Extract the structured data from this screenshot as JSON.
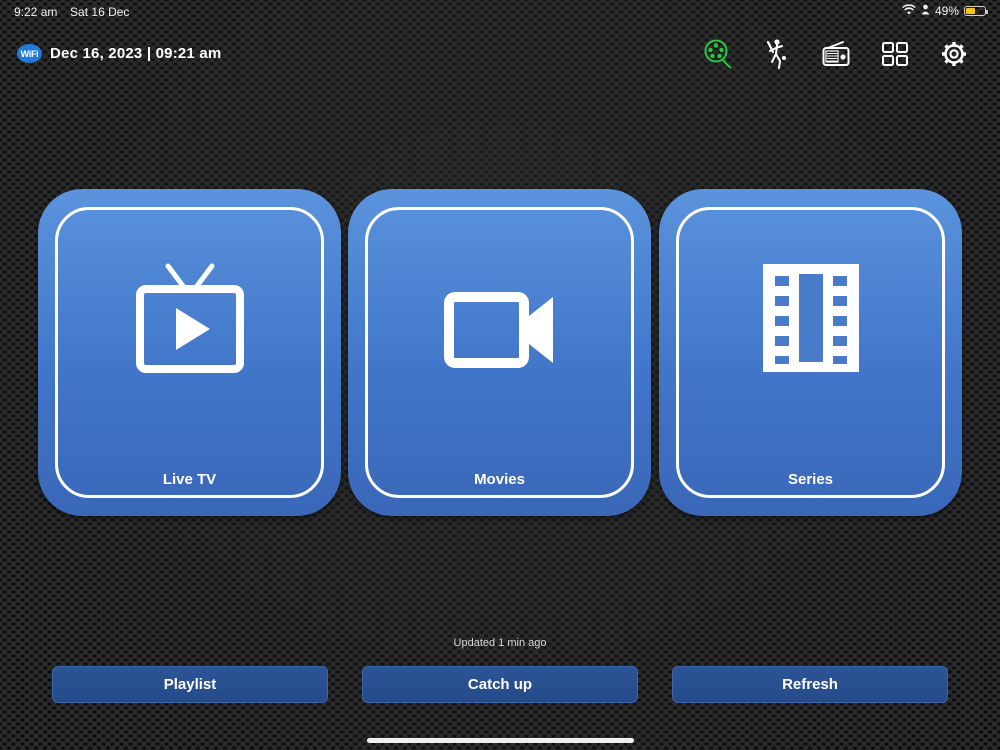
{
  "status_bar": {
    "time": "9:22 am",
    "date": "Sat 16 Dec",
    "battery_percent_label": "49%",
    "battery_level": 0.49,
    "icons": [
      "wifi-icon",
      "person-icon",
      "battery-icon"
    ]
  },
  "header": {
    "wifi_badge": "WiFi",
    "datetime": "Dec 16, 2023 | 09:21 am",
    "icons": [
      "film-reel-icon",
      "cricket-icon",
      "radio-icon",
      "grid-icon",
      "gear-icon"
    ],
    "accent_green": "#27c93f"
  },
  "tiles": [
    {
      "label": "Live TV",
      "icon": "tv-play-icon"
    },
    {
      "label": "Movies",
      "icon": "video-camera-icon"
    },
    {
      "label": "Series",
      "icon": "film-strip-icon"
    }
  ],
  "updated_text": "Updated 1 min ago",
  "buttons": {
    "playlist": "Playlist",
    "catch_up": "Catch up",
    "refresh": "Refresh"
  },
  "colors": {
    "tile_blue": "#4a80d0",
    "button_blue": "#2a5192"
  }
}
